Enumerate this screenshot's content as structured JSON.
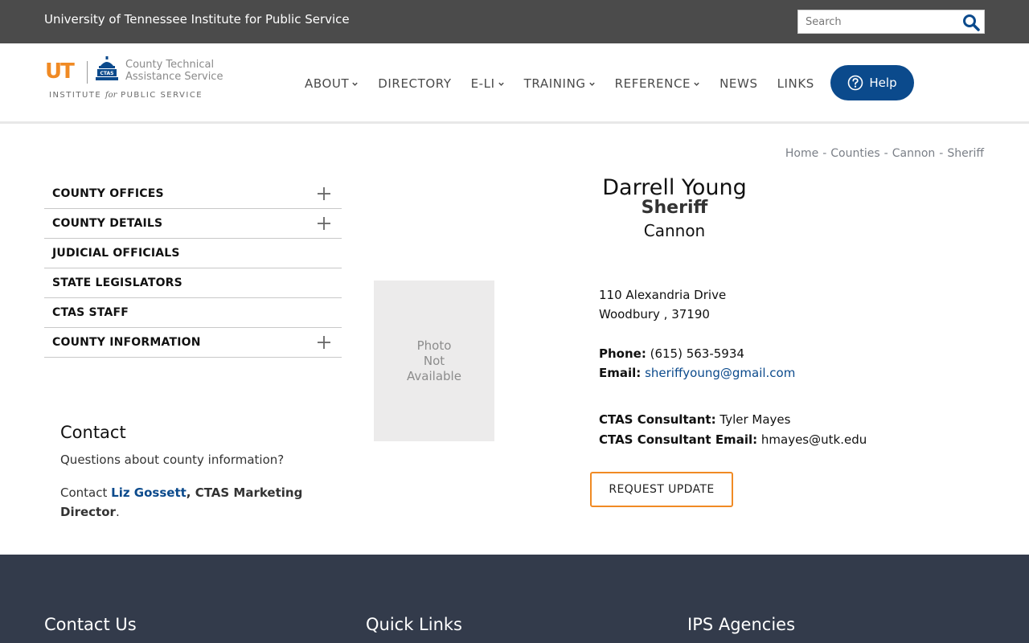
{
  "topbar": {
    "institute": "University of Tennessee Institute for Public Service",
    "search_placeholder": "Search"
  },
  "logo": {
    "ut": "UT",
    "ctas_line1": "County Technical",
    "ctas_line2": "Assistance Service",
    "ips_pre": "INSTITUTE ",
    "ips_for": "for",
    "ips_post": " PUBLIC SERVICE",
    "capitol_text": "CTAS"
  },
  "nav": {
    "items": [
      {
        "label": "ABOUT",
        "dropdown": true
      },
      {
        "label": "DIRECTORY",
        "dropdown": false
      },
      {
        "label": "E-LI",
        "dropdown": true
      },
      {
        "label": "TRAINING",
        "dropdown": true
      },
      {
        "label": "REFERENCE",
        "dropdown": true
      },
      {
        "label": "NEWS",
        "dropdown": false
      },
      {
        "label": "LINKS",
        "dropdown": false
      }
    ],
    "help_label": "Help"
  },
  "breadcrumb": {
    "items": [
      "Home",
      "Counties",
      "Cannon",
      "Sheriff"
    ],
    "separator": "-"
  },
  "sidebar": {
    "items": [
      {
        "label": "COUNTY OFFICES",
        "expandable": true
      },
      {
        "label": "COUNTY DETAILS",
        "expandable": true
      },
      {
        "label": "JUDICIAL OFFICIALS",
        "expandable": false
      },
      {
        "label": "STATE LEGISLATORS",
        "expandable": false
      },
      {
        "label": "CTAS STAFF",
        "expandable": false
      },
      {
        "label": "COUNTY INFORMATION",
        "expandable": true
      }
    ]
  },
  "contact": {
    "heading": "Contact",
    "question": "Questions about county information?",
    "prefix": "Contact ",
    "person": "Liz Gossett",
    "role": ", CTAS Marketing Director",
    "suffix": "."
  },
  "photo": {
    "line1": "Photo",
    "line2": "Not",
    "line3": "Available"
  },
  "profile": {
    "name": "Darrell Young",
    "title": "Sheriff",
    "county": "Cannon",
    "address_line1": "110 Alexandria Drive",
    "address_line2": "Woodbury , 37190",
    "phone_label": "Phone:",
    "phone": "(615) 563-5934",
    "email_label": "Email:",
    "email": "sheriffyoung@gmail.com",
    "consultant_label": "CTAS Consultant:",
    "consultant": "Tyler Mayes",
    "consultant_email_label": "CTAS Consultant Email:",
    "consultant_email": "hmayes@utk.edu",
    "request_button": "REQUEST UPDATE"
  },
  "footer": {
    "col1": "Contact Us",
    "col2": "Quick Links",
    "col3": "IPS Agencies"
  },
  "colors": {
    "topbar_bg": "#4b4b4b",
    "brand_orange": "#f08a24",
    "brand_blue": "#0b4a8c",
    "footer_bg": "#333b4b"
  }
}
